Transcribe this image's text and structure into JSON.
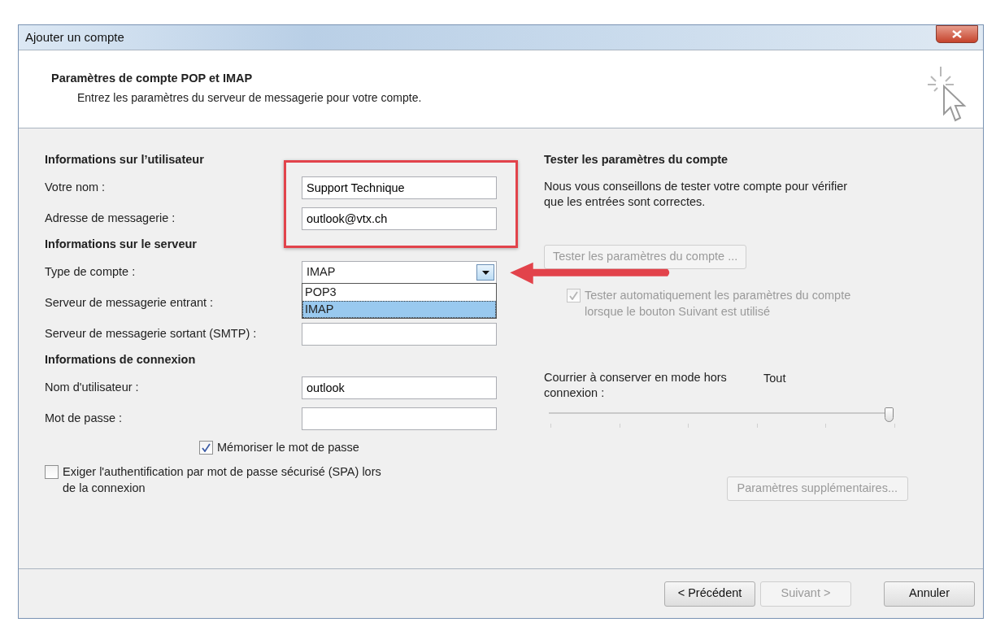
{
  "window": {
    "title": "Ajouter un compte"
  },
  "header": {
    "title": "Paramètres de compte POP et IMAP",
    "subtitle": "Entrez les paramètres du serveur de messagerie pour votre compte."
  },
  "left": [
    {
      "kind": "heading",
      "text": "Informations sur l’utilisateur"
    },
    {
      "kind": "field",
      "label": "Votre nom :",
      "value": "Support Technique"
    },
    {
      "kind": "field",
      "label": "Adresse de messagerie :",
      "value": "outlook@vtx.ch"
    },
    {
      "kind": "heading",
      "text": "Informations sur le serveur"
    },
    {
      "kind": "select",
      "label": "Type de compte :",
      "value": "IMAP",
      "expanded": true,
      "options": [
        {
          "label": "POP3",
          "selected": false
        },
        {
          "label": "IMAP",
          "selected": true
        }
      ]
    },
    {
      "kind": "label",
      "label": "Serveur de messagerie entrant :"
    },
    {
      "kind": "field",
      "label": "Serveur de messagerie sortant (SMTP) :"
    },
    {
      "kind": "heading",
      "text": "Informations de connexion"
    },
    {
      "kind": "field",
      "label": "Nom d'utilisateur :",
      "value": "outlook"
    },
    {
      "kind": "field",
      "label": "Mot de passe :"
    },
    {
      "kind": "inline_checkbox",
      "label": "Mémoriser le mot de passe",
      "checked": true
    },
    {
      "kind": "checkbox",
      "label": "Exiger l'authentification par mot de passe sécurisé (SPA) lors de la connexion",
      "checked": false
    }
  ],
  "right": {
    "heading": "Tester les paramètres du compte",
    "description": "Nous vous conseillons de tester votre compte pour vérifier que les entrées sont correctes.",
    "test_button": {
      "label": "Tester les paramètres du compte ...",
      "disabled": true
    },
    "auto_test": {
      "label": "Tester automatiquement les paramètres du compte lorsque le bouton Suivant est utilisé",
      "checked": true,
      "disabled": true
    },
    "offline": {
      "label": "Courrier à conserver en mode hors connexion :",
      "reading": "Tout",
      "level": 1
    },
    "more_button": {
      "label": "Paramètres supplémentaires...",
      "disabled": true
    }
  },
  "footer": {
    "buttons": [
      {
        "label": "< Précédent",
        "disabled": false
      },
      {
        "label": "Suivant >",
        "disabled": true
      },
      {
        "label": "Annuler",
        "disabled": false
      }
    ]
  }
}
